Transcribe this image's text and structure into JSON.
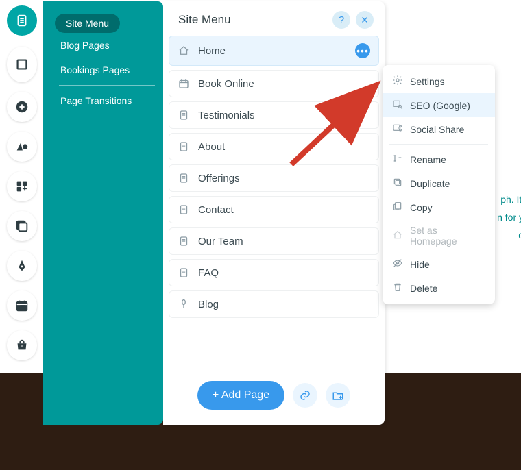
{
  "sidebar": {
    "title_pill": "Site Menu",
    "links": [
      "Blog Pages",
      "Bookings Pages",
      "Page Transitions"
    ]
  },
  "panel": {
    "title": "Site Menu",
    "pages": [
      {
        "label": "Home",
        "icon": "home",
        "active": true,
        "more": true
      },
      {
        "label": "Book Online",
        "icon": "calendar"
      },
      {
        "label": "Testimonials",
        "icon": "page"
      },
      {
        "label": "About",
        "icon": "page"
      },
      {
        "label": "Offerings",
        "icon": "page"
      },
      {
        "label": "Contact",
        "icon": "page"
      },
      {
        "label": "Our Team",
        "icon": "page"
      },
      {
        "label": "FAQ",
        "icon": "page"
      },
      {
        "label": "Blog",
        "icon": "blog"
      }
    ],
    "add_button": "+ Add Page"
  },
  "context_menu": {
    "items": [
      {
        "label": "Settings",
        "icon": "gear"
      },
      {
        "label": "SEO (Google)",
        "icon": "seo",
        "highlight": true
      },
      {
        "label": "Social Share",
        "icon": "share"
      },
      {
        "sep": true
      },
      {
        "label": "Rename",
        "icon": "rename"
      },
      {
        "label": "Duplicate",
        "icon": "duplicate"
      },
      {
        "label": "Copy",
        "icon": "copy"
      },
      {
        "label": "Set as Homepage",
        "icon": "home",
        "disabled": true
      },
      {
        "label": "Hide",
        "icon": "hide"
      },
      {
        "label": "Delete",
        "icon": "delete"
      }
    ]
  },
  "peek_text": [
    "ph. It'",
    "n for y",
    "q"
  ],
  "rail_icons": [
    "pages",
    "section",
    "add",
    "theme",
    "apps",
    "media",
    "pen",
    "booking",
    "store"
  ]
}
